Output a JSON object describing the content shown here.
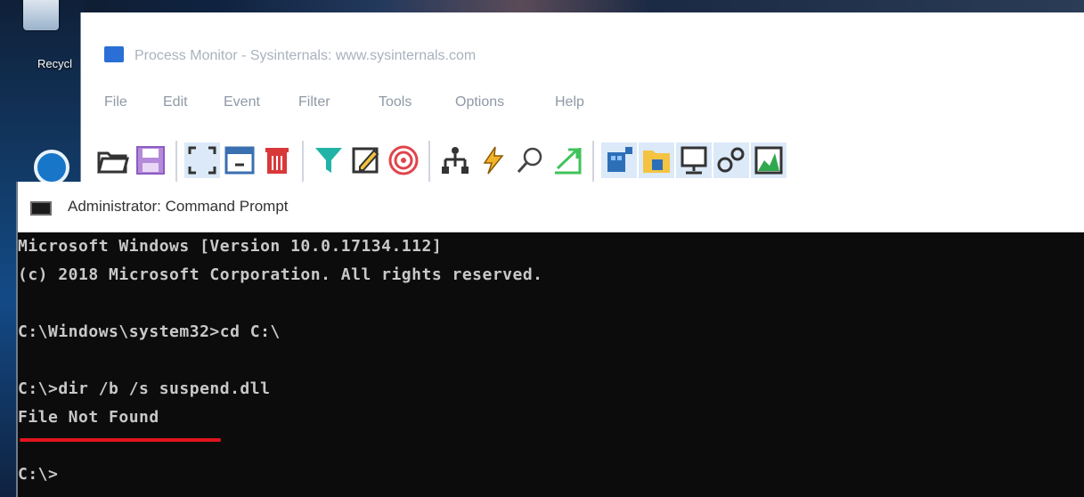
{
  "desktop": {
    "recycle_label": "Recycl"
  },
  "procmon": {
    "title": "Process Monitor - Sysinternals: www.sysinternals.com",
    "menu": [
      "File",
      "Edit",
      "Event",
      "Filter",
      "Tools",
      "Options",
      "Help"
    ],
    "toolbar_icons": [
      "open-folder-icon",
      "save-icon",
      "capture-icon",
      "autoscroll-icon",
      "clear-icon",
      "filter-icon",
      "highlight-icon",
      "target-icon",
      "process-tree-icon",
      "event-properties-icon",
      "find-icon",
      "jump-icon",
      "registry-activity-icon",
      "file-activity-icon",
      "network-activity-icon",
      "process-activity-icon",
      "profiling-icon"
    ]
  },
  "cmd": {
    "title": "Administrator: Command Prompt",
    "lines": [
      "Microsoft Windows [Version 10.0.17134.112]",
      "(c) 2018 Microsoft Corporation. All rights reserved.",
      "",
      "C:\\Windows\\system32>cd C:\\",
      "",
      "C:\\>dir /b /s suspend.dll",
      "File Not Found",
      "",
      "C:\\>"
    ]
  },
  "colors": {
    "annotation_underline": "#e0141e",
    "console_bg": "#0c0c0c",
    "console_fg": "#c8c8c8"
  }
}
